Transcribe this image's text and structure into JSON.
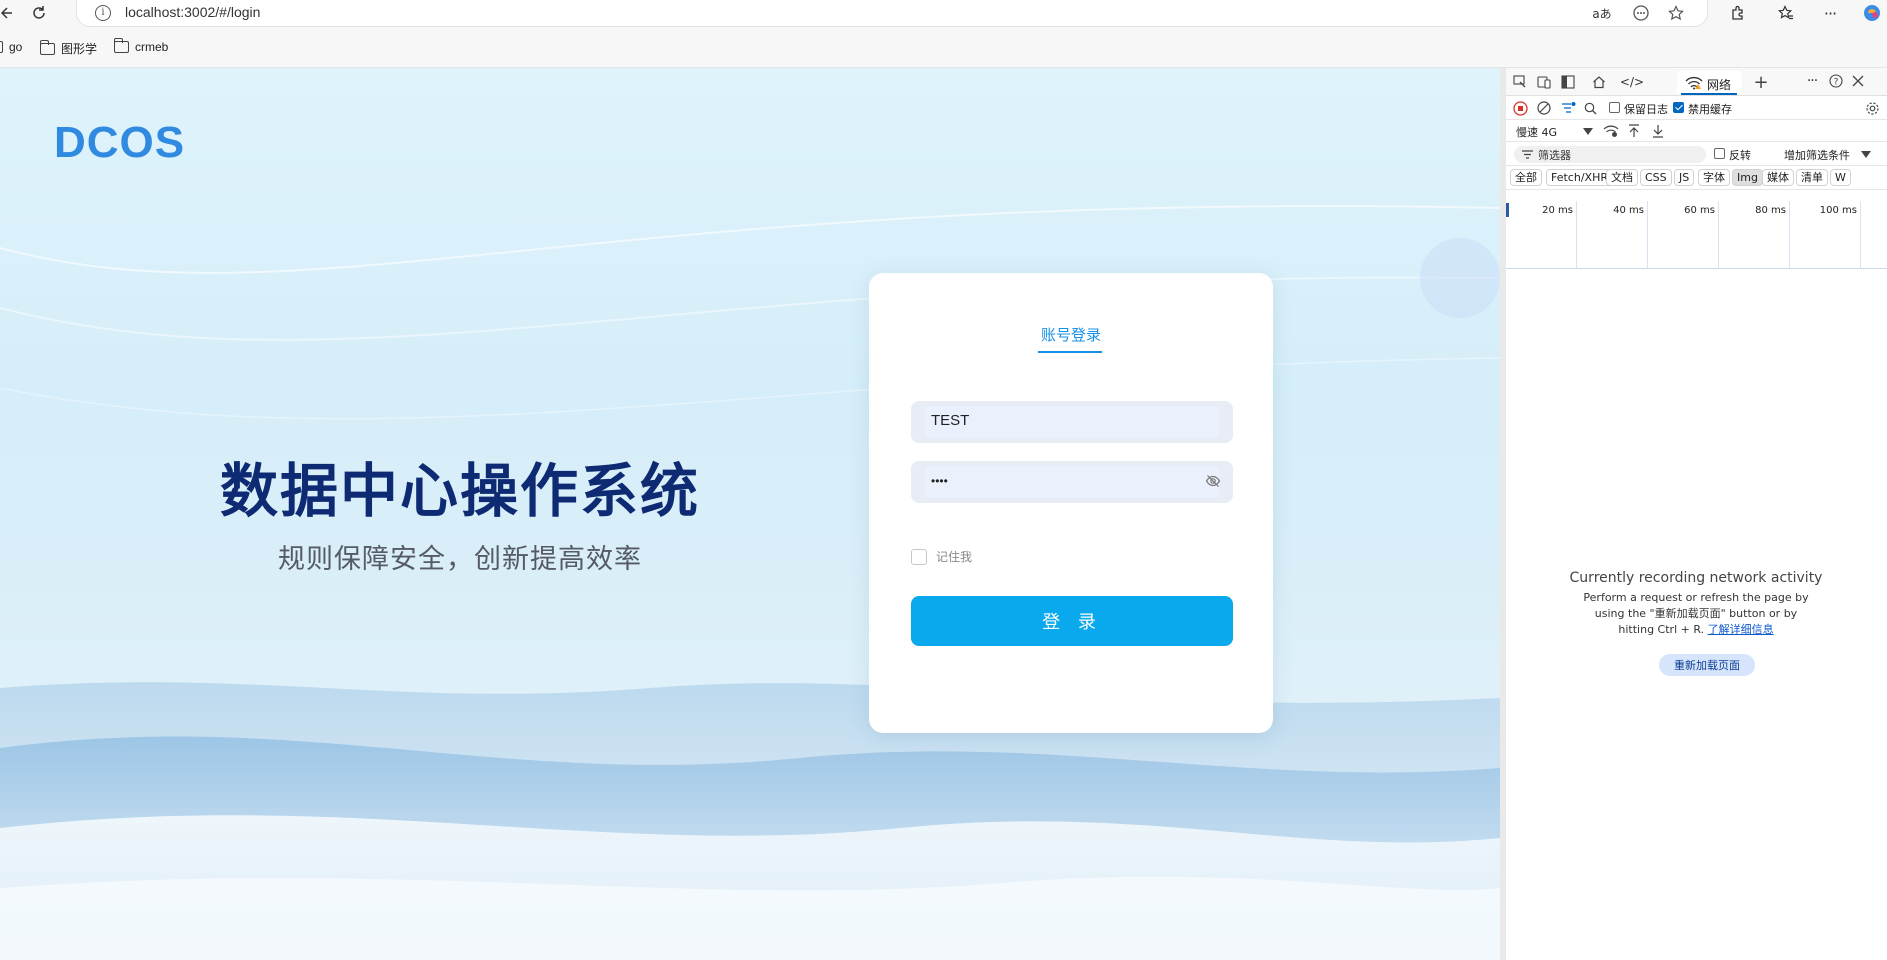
{
  "browser": {
    "url": "localhost:3002/#/login",
    "bookmarks": [
      {
        "label": "go"
      },
      {
        "label": "图形学"
      },
      {
        "label": "crmeb"
      }
    ]
  },
  "login_page": {
    "logo": "DCOS",
    "hero_title": "数据中心操作系统",
    "hero_subtitle": "规则保障安全，创新提高效率",
    "tab_label": "账号登录",
    "username_value": "TEST",
    "password_value": "••••",
    "remember_label": "记住我",
    "remember_checked": false,
    "login_button": "登 录"
  },
  "devtools": {
    "active_tab": "网络",
    "preserve_log_label": "保留日志",
    "preserve_log_checked": false,
    "disable_cache_label": "禁用缓存",
    "disable_cache_checked": true,
    "throttle": "慢速 4G",
    "filter_placeholder": "筛选器",
    "invert_label": "反转",
    "more_filters_label": "增加筛选条件",
    "type_filters": [
      {
        "label": "全部",
        "active": false
      },
      {
        "label": "Fetch/XHR",
        "active": false
      },
      {
        "label": "文档",
        "active": false
      },
      {
        "label": "CSS",
        "active": false
      },
      {
        "label": "JS",
        "active": false
      },
      {
        "label": "字体",
        "active": false
      },
      {
        "label": "Img",
        "active": true
      },
      {
        "label": "媒体",
        "active": false
      },
      {
        "label": "清单",
        "active": false
      }
    ],
    "timeline_ticks": [
      "20 ms",
      "40 ms",
      "60 ms",
      "80 ms",
      "100 ms"
    ],
    "empty_title": "Currently recording network activity",
    "empty_body_line1": "Perform a request or refresh the page by",
    "empty_body_line2": "using the \"重新加载页面\" button or by",
    "empty_body_line3": "hitting Ctrl + R.",
    "learn_more": "了解详细信息",
    "reload_button": "重新加载页面"
  },
  "colors": {
    "brand_blue": "#0aa8ec",
    "title_navy": "#0d2a73",
    "tab_blue": "#1890e8"
  }
}
